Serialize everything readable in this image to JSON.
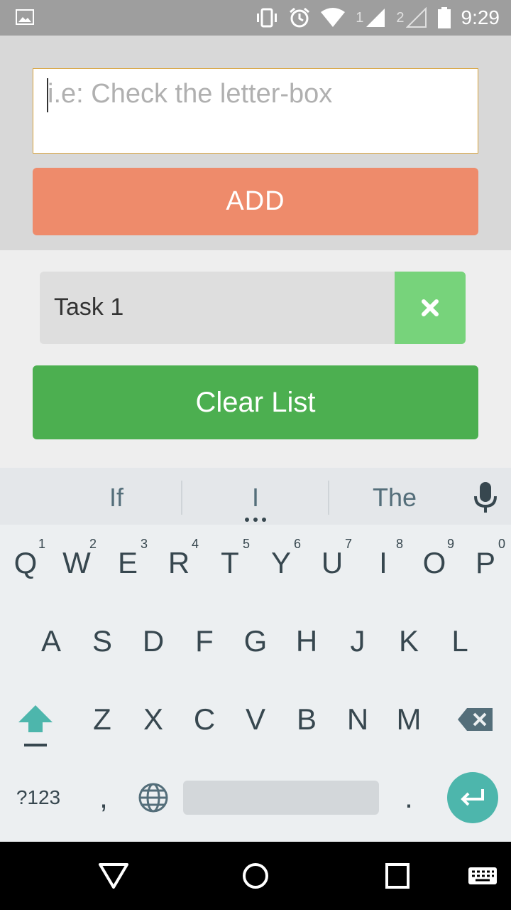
{
  "status_bar": {
    "time": "9:29",
    "sim1_label": "1",
    "sim2_label": "2",
    "icons": [
      "image-icon",
      "vibrate-icon",
      "alarm-icon",
      "wifi-icon",
      "signal-icon",
      "signal-empty-icon",
      "battery-icon"
    ]
  },
  "todo": {
    "input": {
      "placeholder": "i.e: Check the letter-box",
      "value": ""
    },
    "add_label": "ADD",
    "tasks": [
      {
        "label": "Task 1"
      }
    ],
    "clear_label": "Clear List"
  },
  "keyboard": {
    "suggestions": [
      "If",
      "I",
      "The"
    ],
    "rows": [
      [
        {
          "label": "Q",
          "hint": "1"
        },
        {
          "label": "W",
          "hint": "2"
        },
        {
          "label": "E",
          "hint": "3"
        },
        {
          "label": "R",
          "hint": "4"
        },
        {
          "label": "T",
          "hint": "5"
        },
        {
          "label": "Y",
          "hint": "6"
        },
        {
          "label": "U",
          "hint": "7"
        },
        {
          "label": "I",
          "hint": "8"
        },
        {
          "label": "O",
          "hint": "9"
        },
        {
          "label": "P",
          "hint": "0"
        }
      ],
      [
        {
          "label": "A"
        },
        {
          "label": "S"
        },
        {
          "label": "D"
        },
        {
          "label": "F"
        },
        {
          "label": "G"
        },
        {
          "label": "H"
        },
        {
          "label": "J"
        },
        {
          "label": "K"
        },
        {
          "label": "L"
        }
      ],
      [
        {
          "label": "Z"
        },
        {
          "label": "X"
        },
        {
          "label": "C"
        },
        {
          "label": "V"
        },
        {
          "label": "B"
        },
        {
          "label": "N"
        },
        {
          "label": "M"
        }
      ]
    ],
    "symbols_label": "?123",
    "comma_label": ",",
    "period_label": ".",
    "accent_color": "#4db6ac"
  },
  "colors": {
    "add_button": "#ee8b6b",
    "delete_button": "#77d37b",
    "clear_button": "#4caf50"
  },
  "navigation": {
    "icons": [
      "back-icon",
      "home-icon",
      "recents-icon",
      "keyboard-switch-icon"
    ]
  }
}
